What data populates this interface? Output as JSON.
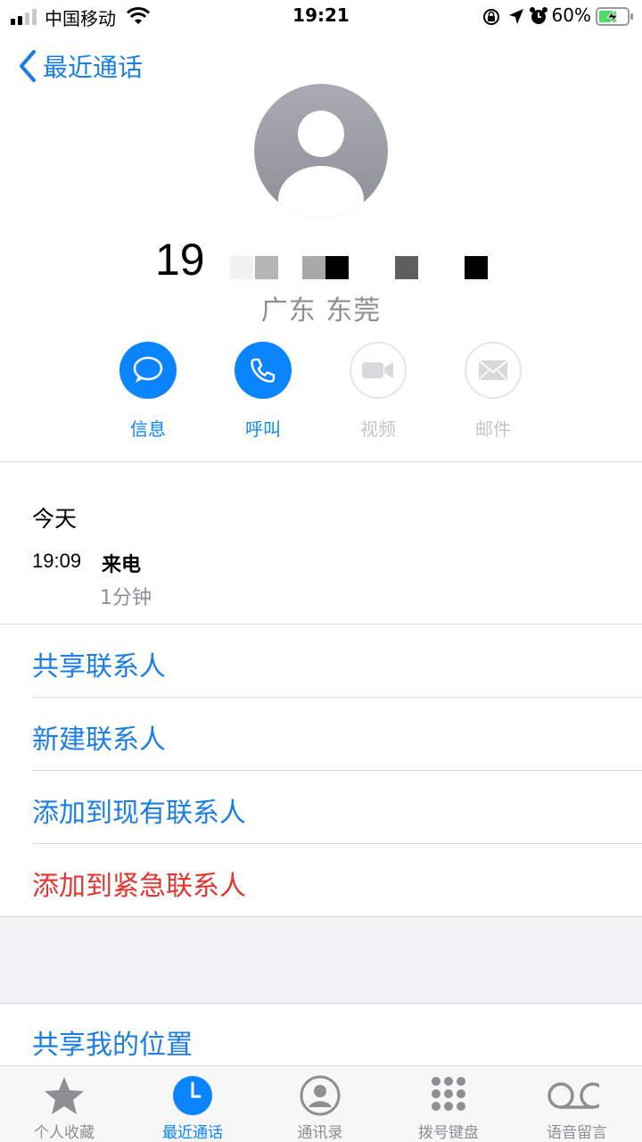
{
  "status_bar": {
    "carrier": "中国移动",
    "time": "19:21",
    "battery_percent": "60%"
  },
  "nav": {
    "back_label": "最近通话"
  },
  "contact": {
    "number_visible": "19",
    "location": "广东 东莞"
  },
  "actions": [
    {
      "label": "信息",
      "enabled": true,
      "icon": "message-bubble-icon"
    },
    {
      "label": "呼叫",
      "enabled": true,
      "icon": "phone-icon"
    },
    {
      "label": "视频",
      "enabled": false,
      "icon": "video-camera-icon"
    },
    {
      "label": "邮件",
      "enabled": false,
      "icon": "mail-envelope-icon"
    }
  ],
  "history": {
    "day": "今天",
    "time": "19:09",
    "type": "来电",
    "duration": "1分钟"
  },
  "options": {
    "share_contact": "共享联系人",
    "new_contact": "新建联系人",
    "add_existing": "添加到现有联系人",
    "add_emergency": "添加到紧急联系人",
    "share_location": "共享我的位置"
  },
  "tabbar": {
    "favorites": "个人收藏",
    "recents": "最近通话",
    "contacts": "通讯录",
    "keypad": "拨号键盘",
    "voicemail": "语音留言"
  },
  "colors": {
    "accent": "#0a84ff",
    "link": "#1a7ee6",
    "destructive": "#e3352f",
    "battery": "#4cd964"
  }
}
